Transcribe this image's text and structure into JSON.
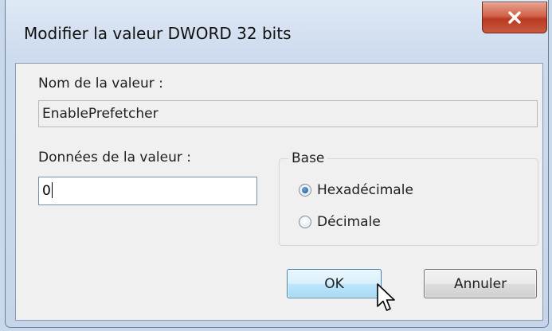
{
  "dialog": {
    "title": "Modifier la valeur DWORD 32 bits",
    "close_icon": "close-icon",
    "value_name_label": "Nom de la valeur :",
    "value_name": "EnablePrefetcher",
    "value_data_label": "Données de la valeur :",
    "value_data": "0",
    "base": {
      "title": "Base",
      "options": [
        {
          "label": "Hexadécimale",
          "selected": true
        },
        {
          "label": "Décimale",
          "selected": false
        }
      ]
    },
    "ok_label": "OK",
    "cancel_label": "Annuler"
  },
  "colors": {
    "close_button": "#c8482f",
    "ok_border": "#3c7fb1",
    "window_frame": "#cddbee"
  }
}
